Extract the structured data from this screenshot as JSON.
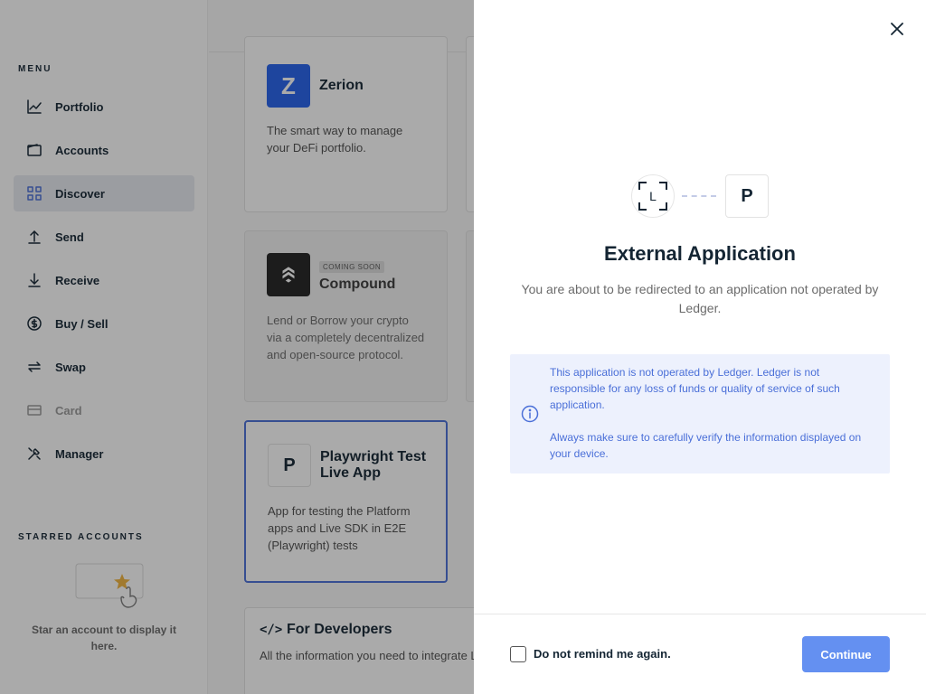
{
  "sidebar": {
    "menu_heading": "MENU",
    "items": [
      {
        "label": "Portfolio",
        "icon": "chart-icon"
      },
      {
        "label": "Accounts",
        "icon": "wallet-icon"
      },
      {
        "label": "Discover",
        "icon": "grid-icon",
        "active": true
      },
      {
        "label": "Send",
        "icon": "arrow-up-icon"
      },
      {
        "label": "Receive",
        "icon": "arrow-down-icon"
      },
      {
        "label": "Buy / Sell",
        "icon": "dollar-icon"
      },
      {
        "label": "Swap",
        "icon": "swap-icon"
      },
      {
        "label": "Card",
        "icon": "card-icon",
        "disabled": true
      },
      {
        "label": "Manager",
        "icon": "tools-icon"
      }
    ],
    "starred_heading": "STARRED ACCOUNTS",
    "starred_empty_text": "Star an account to display it here."
  },
  "catalog": {
    "cards": [
      {
        "title": "Zerion",
        "logo_letter": "Z",
        "description": "The smart way to manage your DeFi portfolio."
      },
      {
        "title": "Compound",
        "badge": "COMING SOON",
        "description": "Lend or Borrow your crypto via a completely decentralized and open-source protocol."
      },
      {
        "title": "Playwright Test Live App",
        "logo_letter": "P",
        "description": "App for testing the Platform apps and Live SDK in E2E (Playwright) tests"
      }
    ],
    "developers": {
      "icon": "</>",
      "title": "For Developers",
      "description": "All the information you need to integrate Live."
    }
  },
  "drawer": {
    "ledger_logo_letter": "L",
    "app_logo_letter": "P",
    "title": "External Application",
    "subtitle": "You are about to be redirected to an application not operated by Ledger.",
    "info_p1": "This application is not operated by Ledger. Ledger is not responsible for any loss of funds or quality of service of such application.",
    "info_p2": "Always make sure to carefully verify the information displayed on your device.",
    "checkbox_label": "Do not remind me again.",
    "checkbox_checked": false,
    "continue_label": "Continue"
  },
  "colors": {
    "accent": "#6490f1",
    "info_bg": "#edf1fd",
    "info_text": "#4a6fd8"
  }
}
